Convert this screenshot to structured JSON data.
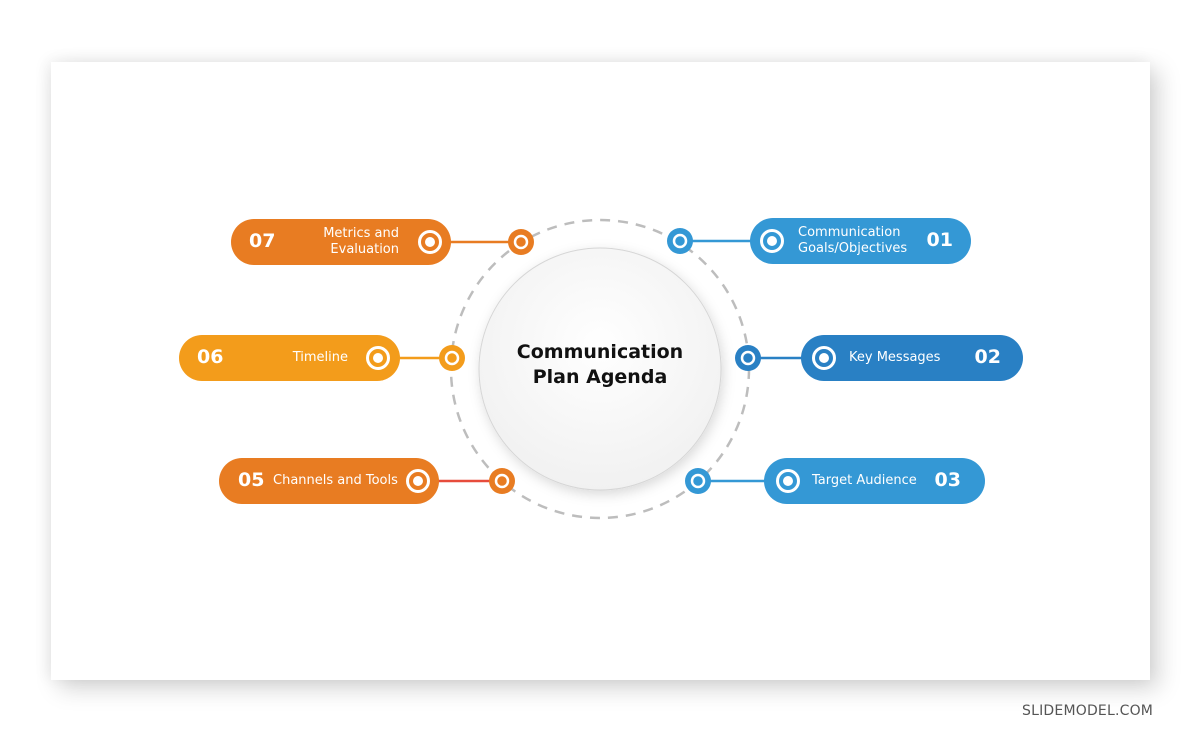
{
  "center": {
    "title_line1": "Communication",
    "title_line2": "Plan Agenda"
  },
  "colors": {
    "orange": "#E87C22",
    "amber": "#F39C1B",
    "blue": "#3498D5",
    "blue_dark": "#2980C4",
    "red_connector": "#E74C3C",
    "dashed_ring": "#BDBDBD"
  },
  "items": [
    {
      "number": "01",
      "label_line1": "Communication",
      "label_line2": "Goals/Objectives",
      "icon": "target-ring-icon"
    },
    {
      "number": "02",
      "label_line1": "Key Messages",
      "label_line2": "",
      "icon": "target-ring-icon"
    },
    {
      "number": "03",
      "label_line1": "Target Audience",
      "label_line2": "",
      "icon": "target-ring-icon"
    },
    {
      "number": "05",
      "label_line1": "Channels and Tools",
      "label_line2": "",
      "icon": "target-ring-icon"
    },
    {
      "number": "06",
      "label_line1": "Timeline",
      "label_line2": "",
      "icon": "target-ring-icon"
    },
    {
      "number": "07",
      "label_line1": "Metrics and",
      "label_line2": "Evaluation",
      "icon": "target-ring-icon"
    }
  ],
  "footer": {
    "brand": "SLIDEMODEL.COM"
  }
}
